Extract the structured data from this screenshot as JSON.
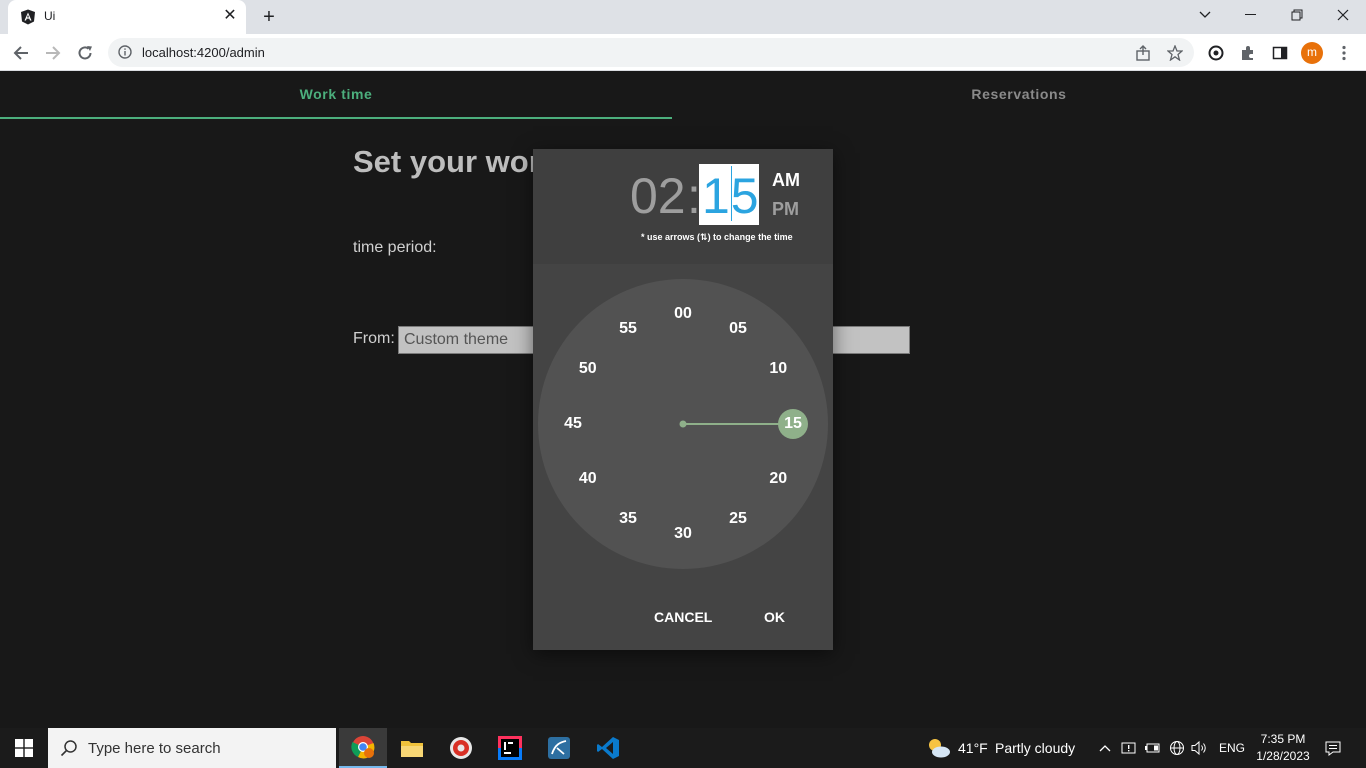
{
  "browser": {
    "tab_title": "Ui",
    "url": "localhost:4200/admin",
    "profile_initial": "m"
  },
  "app": {
    "nav_tabs": [
      "Work time",
      "Reservations"
    ],
    "heading": "Set your wor",
    "period_label": "time period:",
    "from_label": "From:",
    "from_value": "Custom theme"
  },
  "time_picker": {
    "hour": "02",
    "separator": ":",
    "minute": "15",
    "am": "AM",
    "pm": "PM",
    "selected_period": "AM",
    "hint": "* use arrows (⇅) to change the time",
    "dial_labels": [
      "00",
      "05",
      "10",
      "15",
      "20",
      "25",
      "30",
      "35",
      "40",
      "45",
      "50",
      "55"
    ],
    "selected_minute": "15",
    "cancel": "CANCEL",
    "ok": "OK",
    "accent_color": "#8fb08a",
    "minute_color": "#2ba4e0"
  },
  "taskbar": {
    "search_placeholder": "Type here to search",
    "weather_temp": "41°F",
    "weather_text": "Partly cloudy",
    "language": "ENG",
    "time": "7:35 PM",
    "date": "1/28/2023"
  }
}
